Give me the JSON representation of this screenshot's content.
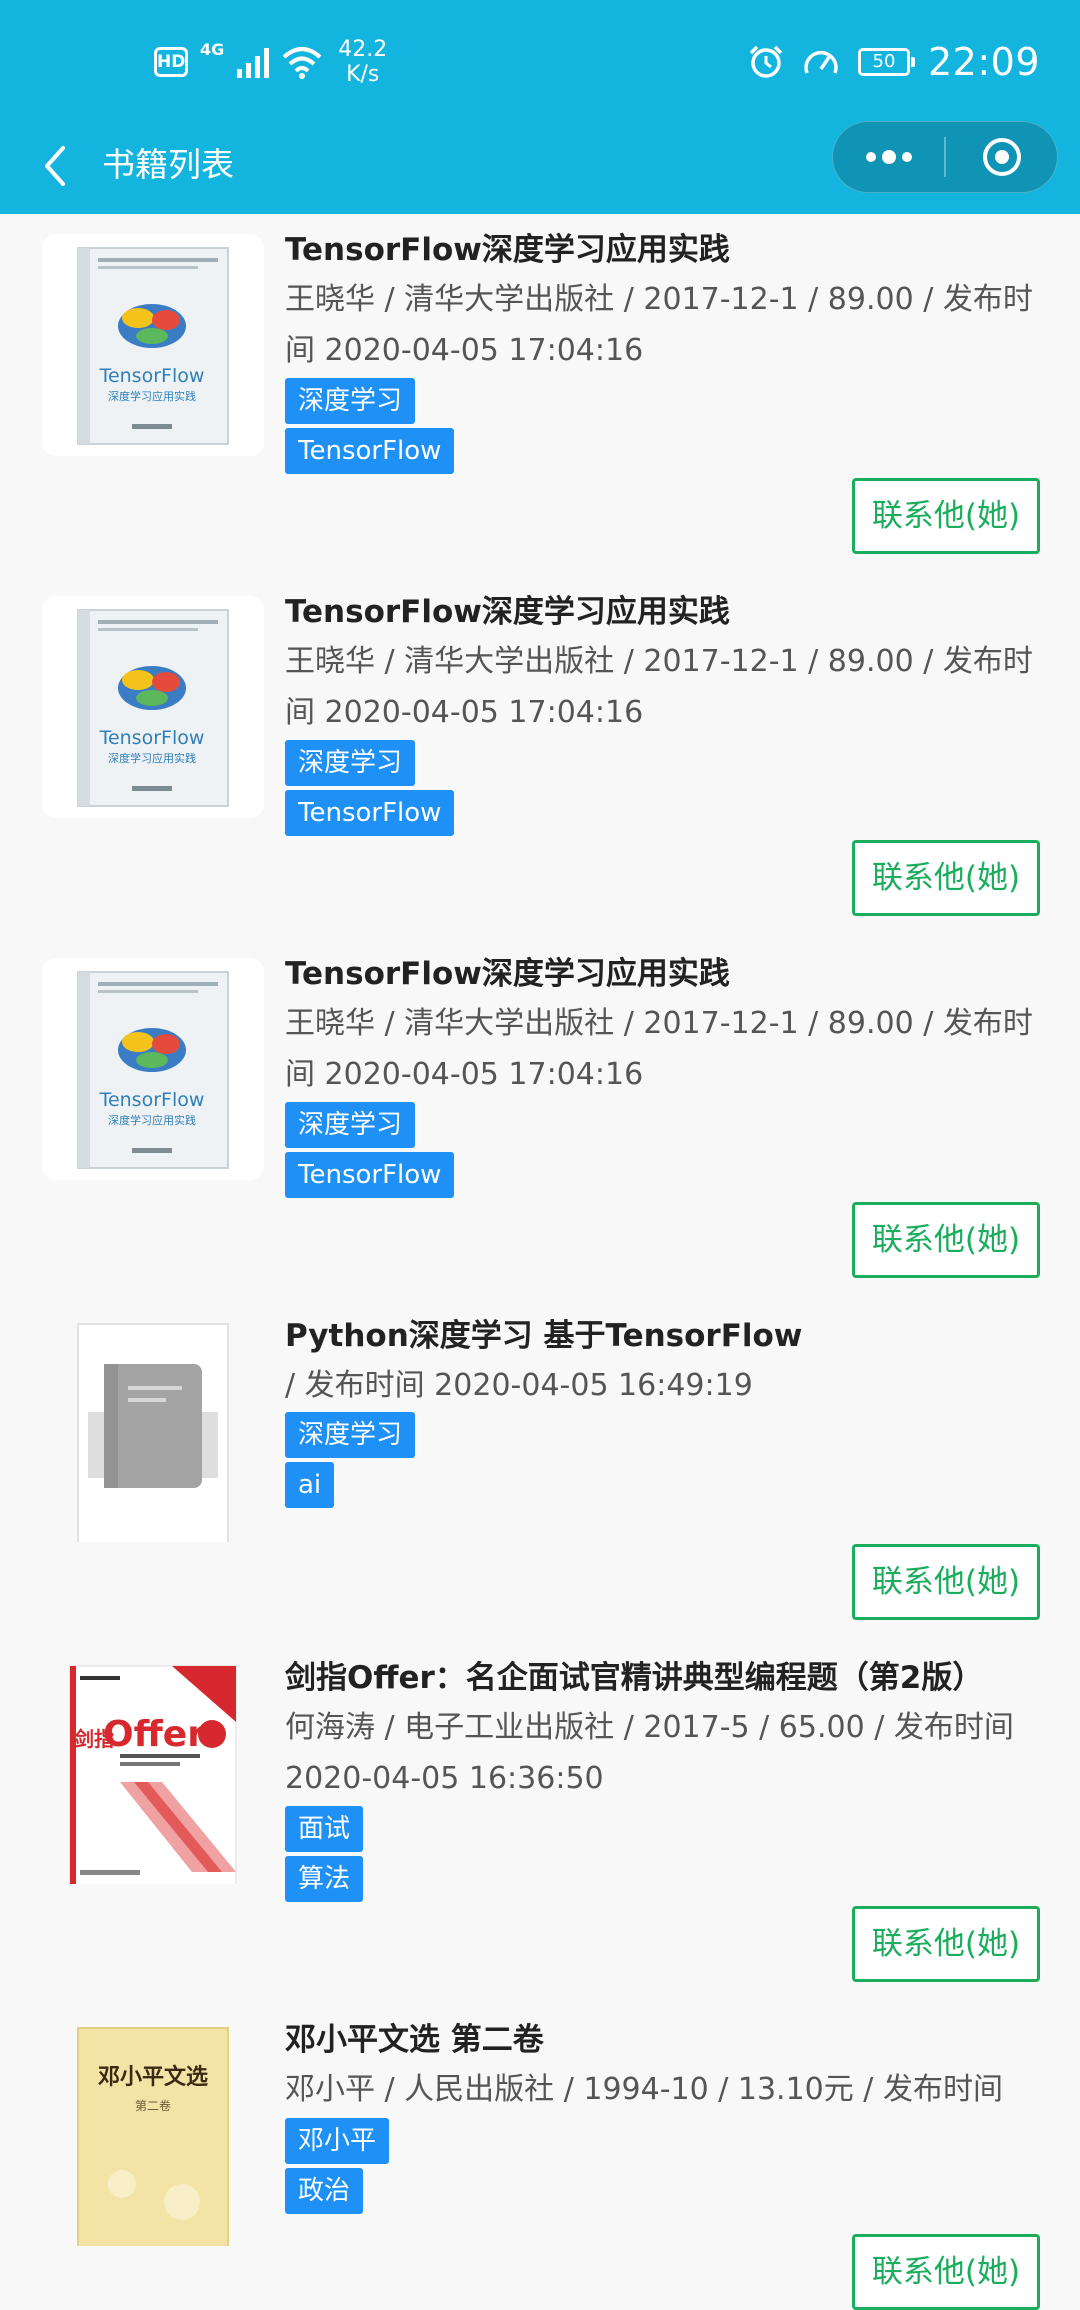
{
  "status_bar": {
    "hd": "HD",
    "network": "4G",
    "speed_value": "42.2",
    "speed_unit": "K/s",
    "battery": "50",
    "time": "22:09",
    "icons": [
      "signal-icon",
      "wifi-icon",
      "alarm-icon",
      "gauge-icon",
      "battery-icon"
    ]
  },
  "nav": {
    "title": "书籍列表",
    "back_icon": "chevron-left-icon",
    "more_icon": "more-dots-icon",
    "close_icon": "target-close-icon"
  },
  "books": [
    {
      "title": "TensorFlow深度学习应用实践",
      "meta": "王晓华 / 清华大学出版社 / 2017-12-1 / 89.00 / 发布时间 2020-04-05 17:04:16",
      "tags": [
        "深度学习",
        "TensorFlow"
      ],
      "contact_label": "联系他(她)",
      "cover_text": "TensorFlow",
      "cover_subtext": "深度学习应用实践"
    },
    {
      "title": "TensorFlow深度学习应用实践",
      "meta": "王晓华 / 清华大学出版社 / 2017-12-1 / 89.00 / 发布时间 2020-04-05 17:04:16",
      "tags": [
        "深度学习",
        "TensorFlow"
      ],
      "contact_label": "联系他(她)",
      "cover_text": "TensorFlow",
      "cover_subtext": "深度学习应用实践"
    },
    {
      "title": "TensorFlow深度学习应用实践",
      "meta": "王晓华 / 清华大学出版社 / 2017-12-1 / 89.00 / 发布时间 2020-04-05 17:04:16",
      "tags": [
        "深度学习",
        "TensorFlow"
      ],
      "contact_label": "联系他(她)",
      "cover_text": "TensorFlow",
      "cover_subtext": "深度学习应用实践"
    },
    {
      "title": "Python深度学习 基于TensorFlow",
      "meta": "/ 发布时间 2020-04-05 16:49:19",
      "tags": [
        "深度学习",
        "ai"
      ],
      "contact_label": "联系他(她)"
    },
    {
      "title": "剑指Offer：名企面试官精讲典型编程题（第2版）",
      "meta": "何海涛 / 电子工业出版社 / 2017-5 / 65.00 / 发布时间 2020-04-05 16:36:50",
      "tags": [
        "面试",
        "算法"
      ],
      "contact_label": "联系他(她)",
      "cover_text": "Offer",
      "cover_subtext": "剑指"
    },
    {
      "title": "邓小平文选 第二卷",
      "meta": "邓小平 / 人民出版社 / 1994-10 / 13.10元 / 发布时间",
      "tags": [
        "邓小平",
        "政治"
      ],
      "contact_label": "联系他(她)",
      "cover_text": "邓小平文选",
      "cover_subtext": "第二卷"
    }
  ],
  "colors": {
    "header_bg": "#13b5df",
    "tag_bg": "#1e90f6",
    "contact_green": "#1aad5c",
    "page_bg": "#f8f8f8"
  }
}
